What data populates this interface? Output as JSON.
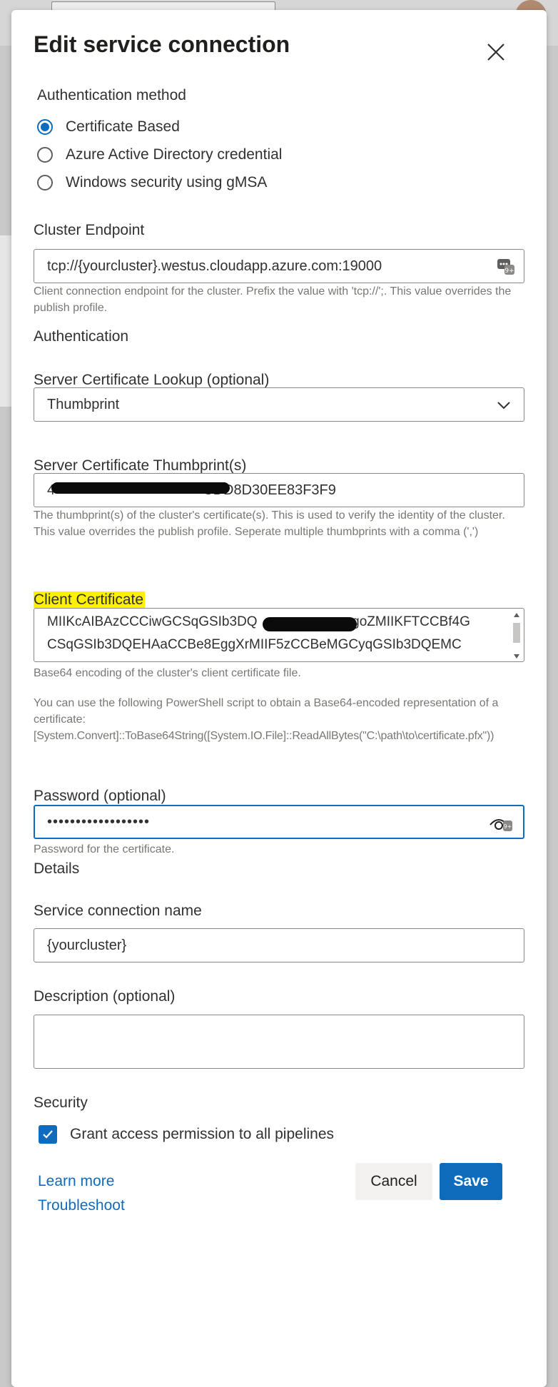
{
  "dialog": {
    "title": "Edit service connection"
  },
  "auth_method": {
    "label": "Authentication method",
    "options": [
      {
        "label": "Certificate Based",
        "selected": true
      },
      {
        "label": "Azure Active Directory credential",
        "selected": false
      },
      {
        "label": "Windows security using gMSA",
        "selected": false
      }
    ]
  },
  "cluster_endpoint": {
    "label": "Cluster Endpoint",
    "value": "tcp://{yourcluster}.westus.cloudapp.azure.com:19000",
    "help": "Client connection endpoint for the cluster. Prefix the value with 'tcp://';. This value overrides the publish profile."
  },
  "authentication_section": {
    "heading": "Authentication"
  },
  "server_cert_lookup": {
    "label": "Server Certificate Lookup (optional)",
    "selected": "Thumbprint"
  },
  "server_cert_thumbprint": {
    "label": "Server Certificate Thumbprint(s)",
    "value_prefix": "4",
    "value_suffix": "CDD8D30EE83F3F9",
    "help": "The thumbprint(s) of the cluster's certificate(s). This is used to verify the identity of the cluster. This value overrides the publish profile. Seperate multiple thumbprints with a comma (',')"
  },
  "client_certificate": {
    "label": "Client Certificate",
    "line1_prefix": "MIIKcAIBAzCCCiwGCSqGSIb3DQ",
    "line1_suffix": "ggoZMIIKFTCCBf4G",
    "line2": "CSqGSIb3DQEHAaCCBe8EggXrMIIF5zCCBeMGCyqGSIb3DQEMC",
    "help": "Base64 encoding of the cluster's client certificate file.",
    "help2_text": "You can use the following PowerShell script to obtain a Base64-encoded representation of a certificate:",
    "help2_script": "[System.Convert]::ToBase64String([System.IO.File]::ReadAllBytes(\"C:\\path\\to\\certificate.pfx\"))"
  },
  "password": {
    "label": "Password (optional)",
    "value": "••••••••••••••••••",
    "help": "Password for the certificate."
  },
  "details_section": {
    "heading": "Details"
  },
  "service_connection_name": {
    "label": "Service connection name",
    "value": "{yourcluster}"
  },
  "description": {
    "label": "Description (optional)",
    "value": ""
  },
  "security": {
    "heading": "Security",
    "grant_label": "Grant access permission to all pipelines",
    "grant_checked": true
  },
  "links": {
    "learn_more": "Learn more",
    "troubleshoot": "Troubleshoot"
  },
  "buttons": {
    "cancel": "Cancel",
    "save": "Save"
  },
  "colors": {
    "accent": "#0f6cbd",
    "highlight": "#fff200"
  }
}
